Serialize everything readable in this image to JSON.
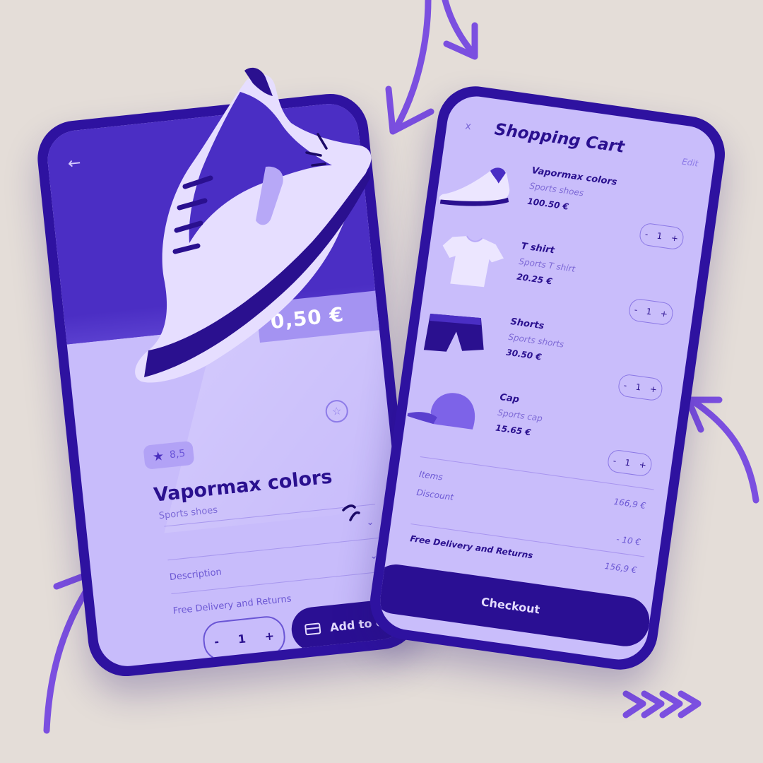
{
  "product": {
    "name": "Vapormax colors",
    "category": "Sports shoes",
    "price_visible": "0,50 €",
    "rating": "8,5",
    "rows": [
      "Description",
      "Free Delivery and Returns"
    ],
    "quantity": "1",
    "minus": "-",
    "plus": "+",
    "add_to_cart": "Add to cart",
    "back_icon": "back-arrow-icon",
    "favorite_icon": "star-outline-icon"
  },
  "cart": {
    "close": "x",
    "title": "Shopping Cart",
    "edit": "Edit",
    "items": [
      {
        "name": "Vapormax colors",
        "category": "Sports shoes",
        "price": "100.50 €",
        "qty": "1",
        "thumb": "sneaker-icon"
      },
      {
        "name": "T shirt",
        "category": "Sports T shirt",
        "price": "20.25 €",
        "qty": "1",
        "thumb": "tshirt-icon"
      },
      {
        "name": "Shorts",
        "category": "Sports shorts",
        "price": "30.50 €",
        "qty": "1",
        "thumb": "shorts-icon"
      },
      {
        "name": "Cap",
        "category": "Sports cap",
        "price": "15.65 €",
        "qty": "1",
        "thumb": "cap-icon"
      }
    ],
    "items_label": "Items",
    "items_value": "166,9 €",
    "discount_label": "Discount",
    "discount_value": "- 10 €",
    "delivery_label": "Free Delivery and Returns",
    "total_value": "156,9 €",
    "checkout": "Checkout",
    "minus": "-",
    "plus": "+"
  },
  "colors": {
    "background": "#e4ddd8",
    "phone_frame": "#2e12a0",
    "screen": "#c8bcfb",
    "accent": "#2a0f93",
    "arrow": "#7b4fe0"
  }
}
